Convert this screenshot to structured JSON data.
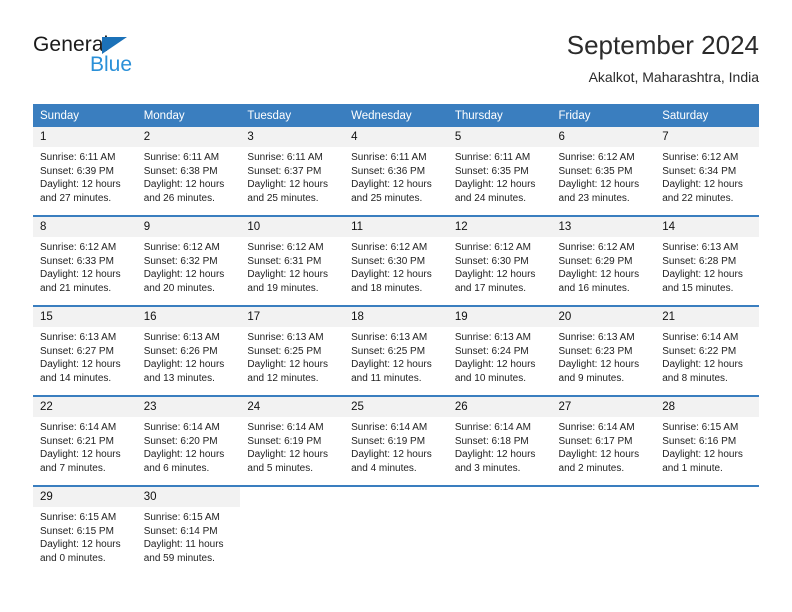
{
  "logo": {
    "word1": "General",
    "word2": "Blue",
    "triangle_color": "#1b71b8",
    "blue_color": "#2a90d8",
    "icon": "triangle-flag-icon"
  },
  "header": {
    "title": "September 2024",
    "subtitle": "Akalkot, Maharashtra, India"
  },
  "theme": {
    "header_bg": "#3a7ebf",
    "header_text": "#ffffff",
    "daynum_bg": "#f2f2f2",
    "cell_bg": "#ffffff"
  },
  "weekdays": [
    "Sunday",
    "Monday",
    "Tuesday",
    "Wednesday",
    "Thursday",
    "Friday",
    "Saturday"
  ],
  "weeks": [
    [
      {
        "day": "1",
        "sunrise": "Sunrise: 6:11 AM",
        "sunset": "Sunset: 6:39 PM",
        "daylight": "Daylight: 12 hours and 27 minutes."
      },
      {
        "day": "2",
        "sunrise": "Sunrise: 6:11 AM",
        "sunset": "Sunset: 6:38 PM",
        "daylight": "Daylight: 12 hours and 26 minutes."
      },
      {
        "day": "3",
        "sunrise": "Sunrise: 6:11 AM",
        "sunset": "Sunset: 6:37 PM",
        "daylight": "Daylight: 12 hours and 25 minutes."
      },
      {
        "day": "4",
        "sunrise": "Sunrise: 6:11 AM",
        "sunset": "Sunset: 6:36 PM",
        "daylight": "Daylight: 12 hours and 25 minutes."
      },
      {
        "day": "5",
        "sunrise": "Sunrise: 6:11 AM",
        "sunset": "Sunset: 6:35 PM",
        "daylight": "Daylight: 12 hours and 24 minutes."
      },
      {
        "day": "6",
        "sunrise": "Sunrise: 6:12 AM",
        "sunset": "Sunset: 6:35 PM",
        "daylight": "Daylight: 12 hours and 23 minutes."
      },
      {
        "day": "7",
        "sunrise": "Sunrise: 6:12 AM",
        "sunset": "Sunset: 6:34 PM",
        "daylight": "Daylight: 12 hours and 22 minutes."
      }
    ],
    [
      {
        "day": "8",
        "sunrise": "Sunrise: 6:12 AM",
        "sunset": "Sunset: 6:33 PM",
        "daylight": "Daylight: 12 hours and 21 minutes."
      },
      {
        "day": "9",
        "sunrise": "Sunrise: 6:12 AM",
        "sunset": "Sunset: 6:32 PM",
        "daylight": "Daylight: 12 hours and 20 minutes."
      },
      {
        "day": "10",
        "sunrise": "Sunrise: 6:12 AM",
        "sunset": "Sunset: 6:31 PM",
        "daylight": "Daylight: 12 hours and 19 minutes."
      },
      {
        "day": "11",
        "sunrise": "Sunrise: 6:12 AM",
        "sunset": "Sunset: 6:30 PM",
        "daylight": "Daylight: 12 hours and 18 minutes."
      },
      {
        "day": "12",
        "sunrise": "Sunrise: 6:12 AM",
        "sunset": "Sunset: 6:30 PM",
        "daylight": "Daylight: 12 hours and 17 minutes."
      },
      {
        "day": "13",
        "sunrise": "Sunrise: 6:12 AM",
        "sunset": "Sunset: 6:29 PM",
        "daylight": "Daylight: 12 hours and 16 minutes."
      },
      {
        "day": "14",
        "sunrise": "Sunrise: 6:13 AM",
        "sunset": "Sunset: 6:28 PM",
        "daylight": "Daylight: 12 hours and 15 minutes."
      }
    ],
    [
      {
        "day": "15",
        "sunrise": "Sunrise: 6:13 AM",
        "sunset": "Sunset: 6:27 PM",
        "daylight": "Daylight: 12 hours and 14 minutes."
      },
      {
        "day": "16",
        "sunrise": "Sunrise: 6:13 AM",
        "sunset": "Sunset: 6:26 PM",
        "daylight": "Daylight: 12 hours and 13 minutes."
      },
      {
        "day": "17",
        "sunrise": "Sunrise: 6:13 AM",
        "sunset": "Sunset: 6:25 PM",
        "daylight": "Daylight: 12 hours and 12 minutes."
      },
      {
        "day": "18",
        "sunrise": "Sunrise: 6:13 AM",
        "sunset": "Sunset: 6:25 PM",
        "daylight": "Daylight: 12 hours and 11 minutes."
      },
      {
        "day": "19",
        "sunrise": "Sunrise: 6:13 AM",
        "sunset": "Sunset: 6:24 PM",
        "daylight": "Daylight: 12 hours and 10 minutes."
      },
      {
        "day": "20",
        "sunrise": "Sunrise: 6:13 AM",
        "sunset": "Sunset: 6:23 PM",
        "daylight": "Daylight: 12 hours and 9 minutes."
      },
      {
        "day": "21",
        "sunrise": "Sunrise: 6:14 AM",
        "sunset": "Sunset: 6:22 PM",
        "daylight": "Daylight: 12 hours and 8 minutes."
      }
    ],
    [
      {
        "day": "22",
        "sunrise": "Sunrise: 6:14 AM",
        "sunset": "Sunset: 6:21 PM",
        "daylight": "Daylight: 12 hours and 7 minutes."
      },
      {
        "day": "23",
        "sunrise": "Sunrise: 6:14 AM",
        "sunset": "Sunset: 6:20 PM",
        "daylight": "Daylight: 12 hours and 6 minutes."
      },
      {
        "day": "24",
        "sunrise": "Sunrise: 6:14 AM",
        "sunset": "Sunset: 6:19 PM",
        "daylight": "Daylight: 12 hours and 5 minutes."
      },
      {
        "day": "25",
        "sunrise": "Sunrise: 6:14 AM",
        "sunset": "Sunset: 6:19 PM",
        "daylight": "Daylight: 12 hours and 4 minutes."
      },
      {
        "day": "26",
        "sunrise": "Sunrise: 6:14 AM",
        "sunset": "Sunset: 6:18 PM",
        "daylight": "Daylight: 12 hours and 3 minutes."
      },
      {
        "day": "27",
        "sunrise": "Sunrise: 6:14 AM",
        "sunset": "Sunset: 6:17 PM",
        "daylight": "Daylight: 12 hours and 2 minutes."
      },
      {
        "day": "28",
        "sunrise": "Sunrise: 6:15 AM",
        "sunset": "Sunset: 6:16 PM",
        "daylight": "Daylight: 12 hours and 1 minute."
      }
    ],
    [
      {
        "day": "29",
        "sunrise": "Sunrise: 6:15 AM",
        "sunset": "Sunset: 6:15 PM",
        "daylight": "Daylight: 12 hours and 0 minutes."
      },
      {
        "day": "30",
        "sunrise": "Sunrise: 6:15 AM",
        "sunset": "Sunset: 6:14 PM",
        "daylight": "Daylight: 11 hours and 59 minutes."
      },
      {
        "day": "",
        "sunrise": "",
        "sunset": "",
        "daylight": ""
      },
      {
        "day": "",
        "sunrise": "",
        "sunset": "",
        "daylight": ""
      },
      {
        "day": "",
        "sunrise": "",
        "sunset": "",
        "daylight": ""
      },
      {
        "day": "",
        "sunrise": "",
        "sunset": "",
        "daylight": ""
      },
      {
        "day": "",
        "sunrise": "",
        "sunset": "",
        "daylight": ""
      }
    ]
  ]
}
